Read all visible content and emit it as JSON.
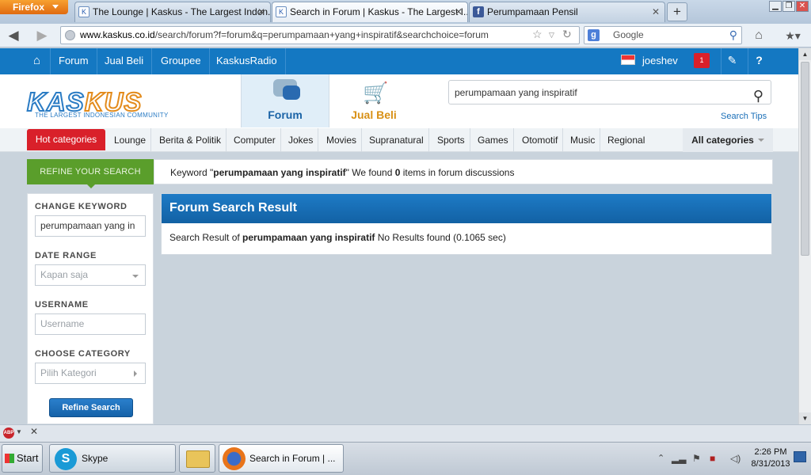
{
  "browser": {
    "app_button": "Firefox",
    "tabs": [
      {
        "title": "The Lounge | Kaskus - The Largest Indon...",
        "icon": "kaskus-favicon"
      },
      {
        "title": "Search in Forum | Kaskus - The Largest I...",
        "icon": "kaskus-favicon",
        "active": true
      },
      {
        "title": "Perumpamaan Pensil",
        "icon": "facebook-favicon"
      }
    ],
    "new_tab": "+",
    "url_host": "www.kaskus.co.id",
    "url_path": "/search/forum?f=forum&q=perumpamaan+yang+inspiratif&searchchoice=forum",
    "search_engine": "Google",
    "search_placeholder": "Google"
  },
  "kaskus_bar": {
    "items": [
      "Forum",
      "Jual Beli",
      "Groupee",
      "KaskusRadio"
    ],
    "username": "joeshev",
    "notification_count": "1"
  },
  "header": {
    "logo_text_a": "KAS",
    "logo_text_b": "KUS",
    "logo_sub": "THE LARGEST INDONESIAN COMMUNITY",
    "forum_tab": "Forum",
    "jualbeli_tab": "Jual Beli",
    "search_value": "perumpamaan yang inspiratif",
    "search_tips": "Search Tips"
  },
  "categories": {
    "hot": "Hot categories",
    "items": [
      "Lounge",
      "Berita & Politik",
      "Computer",
      "Jokes",
      "Movies",
      "Supranatural",
      "Sports",
      "Games",
      "Otomotif",
      "Music",
      "Regional"
    ],
    "all": "All categories"
  },
  "refine": {
    "title": "REFINE YOUR SEARCH",
    "msg_prefix": "Keyword \"",
    "keyword": "perumpamaan yang inspiratif",
    "msg_mid": "\" We found ",
    "count": "0",
    "msg_suffix": " items in forum discussions"
  },
  "sidebar": {
    "change_keyword_label": "CHANGE KEYWORD",
    "change_keyword_value": "perumpamaan yang in",
    "date_range_label": "DATE RANGE",
    "date_range_value": "Kapan saja",
    "username_label": "USERNAME",
    "username_placeholder": "Username",
    "category_label": "CHOOSE CATEGORY",
    "category_value": "Pilih Kategori",
    "refine_button": "Refine Search"
  },
  "results": {
    "title": "Forum Search Result",
    "prefix": "Search Result of ",
    "keyword": "perumpamaan yang inspiratif",
    "suffix": " No Results found (0.1065 sec)"
  },
  "taskbar": {
    "start": "Start",
    "tasks": [
      "Skype",
      "",
      "Search in Forum | ..."
    ],
    "time": "2:26 PM",
    "date": "8/31/2013"
  }
}
